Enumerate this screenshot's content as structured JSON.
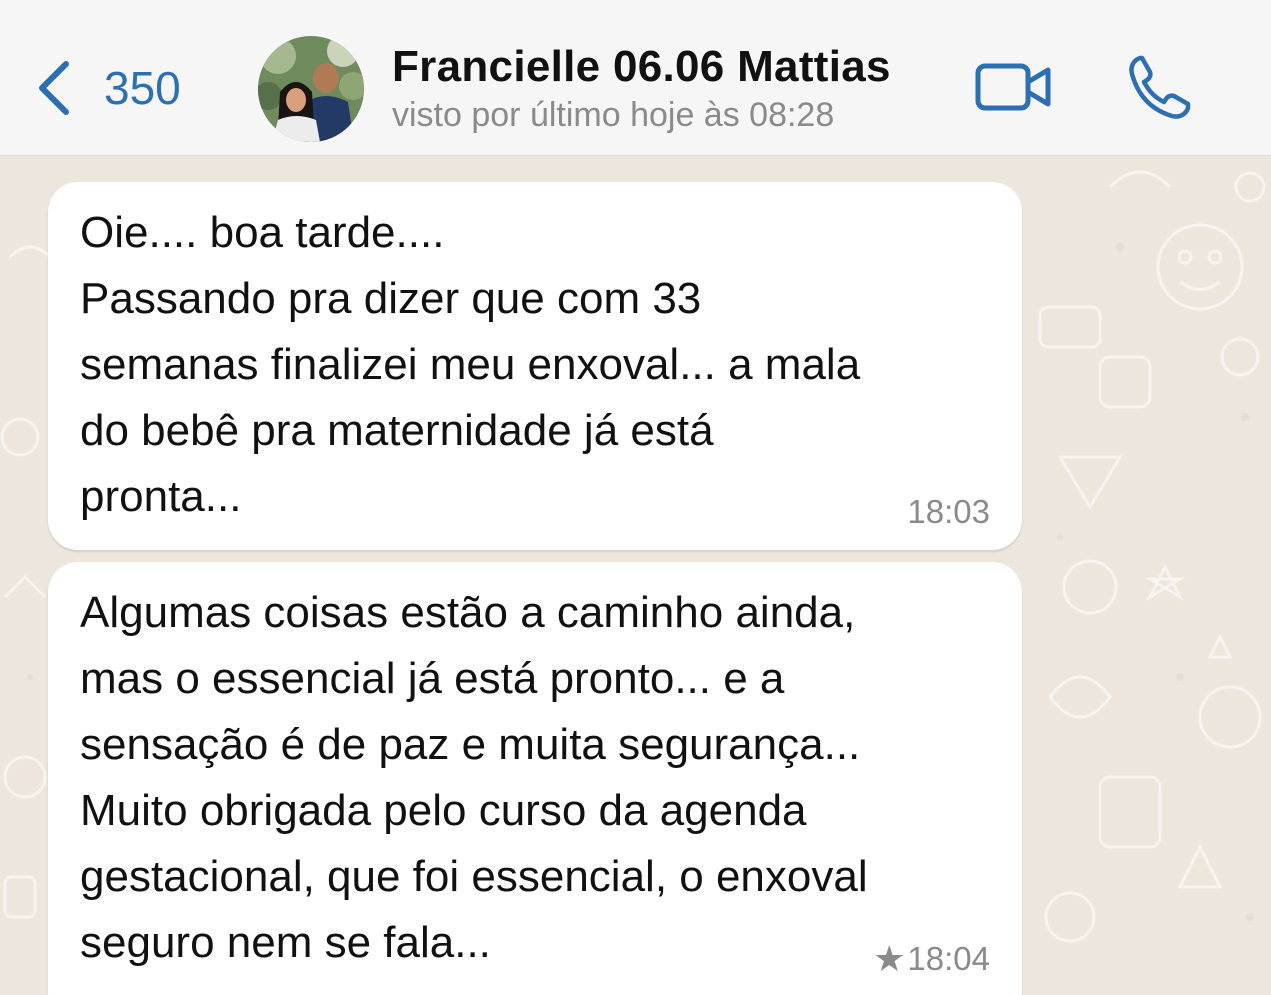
{
  "header": {
    "back_count": "350",
    "contact_name": "Francielle 06.06 Mattias",
    "status": "visto por último hoje às 08:28"
  },
  "colors": {
    "accent": "#2d6fb3",
    "header_bg": "#f6f6f6",
    "chat_bg": "#ece6dc",
    "bubble_bg": "#ffffff"
  },
  "icons": {
    "back": "chevron-left-icon",
    "video": "video-camera-icon",
    "phone": "phone-icon",
    "star": "star-icon"
  },
  "messages": [
    {
      "lines": [
        "Oie.... boa tarde....",
        "Passando pra dizer que com 33",
        "semanas finalizei meu enxoval... a mala",
        "do bebê pra maternidade já está",
        "pronta..."
      ],
      "time": "18:03",
      "starred": false
    },
    {
      "lines": [
        "Algumas coisas estão a caminho ainda,",
        "mas o essencial já está pronto... e a",
        "sensação é de paz e muita segurança...",
        "Muito obrigada pelo curso da agenda",
        "gestacional, que foi essencial, o enxoval",
        "seguro nem se fala..."
      ],
      "time": "18:04",
      "starred": true,
      "star_glyph": "★"
    }
  ]
}
